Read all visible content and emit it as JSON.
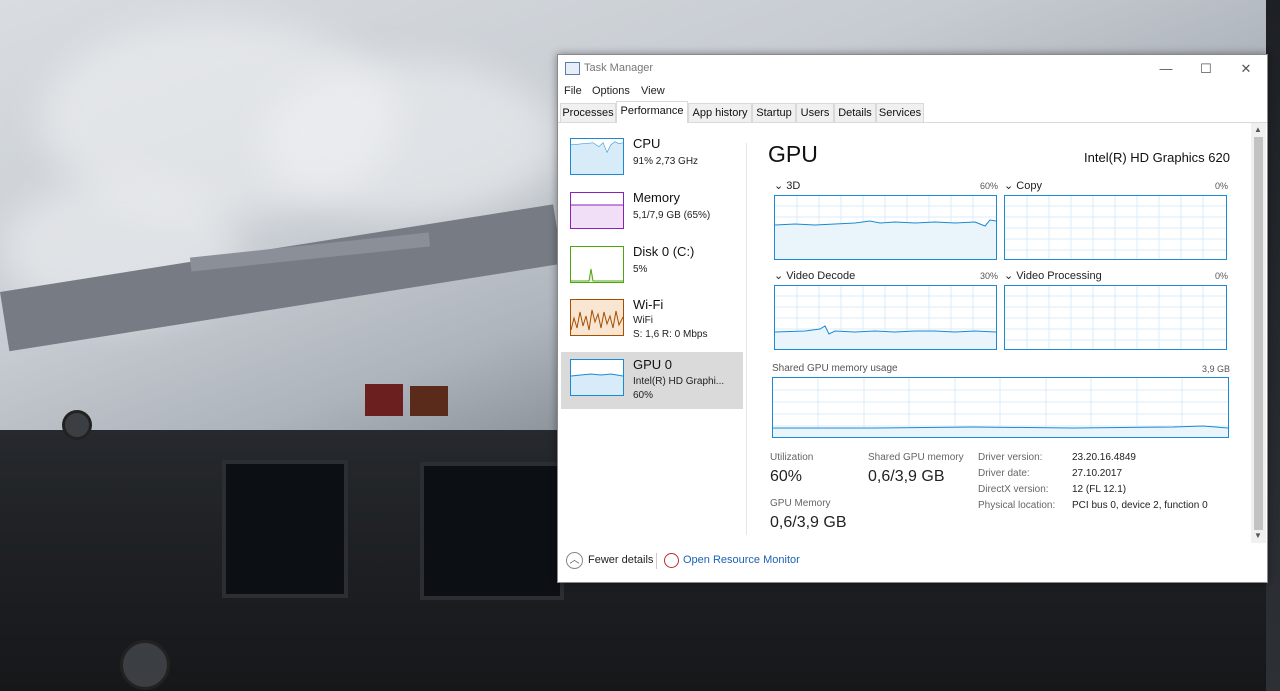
{
  "window": {
    "title": "Task Manager",
    "controls": {
      "minimize": "—",
      "maximize": "☐",
      "close": "✕"
    }
  },
  "menu": [
    "File",
    "Options",
    "View"
  ],
  "tabs": [
    "Processes",
    "Performance",
    "App history",
    "Startup",
    "Users",
    "Details",
    "Services"
  ],
  "active_tab": "Performance",
  "sidebar": [
    {
      "title": "CPU",
      "lines": [
        "91% 2,73 GHz"
      ],
      "color": "#1a8ad4"
    },
    {
      "title": "Memory",
      "lines": [
        "5,1/7,9 GB (65%)"
      ],
      "color": "#8b22b8"
    },
    {
      "title": "Disk 0 (C:)",
      "lines": [
        "5%"
      ],
      "color": "#4da60c"
    },
    {
      "title": "Wi-Fi",
      "lines": [
        "WiFi",
        "S: 1,6 R: 0 Mbps"
      ],
      "color": "#a74f01"
    },
    {
      "title": "GPU 0",
      "lines": [
        "Intel(R) HD Graphi...",
        "60%"
      ],
      "color": "#1a8ad4"
    }
  ],
  "gpu": {
    "heading": "GPU",
    "model": "Intel(R) HD Graphics 620",
    "engines": [
      {
        "name": "3D",
        "max": "60%"
      },
      {
        "name": "Copy",
        "max": "0%"
      },
      {
        "name": "Video Decode",
        "max": "30%"
      },
      {
        "name": "Video Processing",
        "max": "0%"
      }
    ],
    "shared_label": "Shared GPU memory usage",
    "shared_max": "3,9 GB",
    "stats": {
      "utilization_label": "Utilization",
      "utilization": "60%",
      "shared_label": "Shared GPU memory",
      "shared": "0,6/3,9 GB",
      "gpu_memory_label": "GPU Memory",
      "gpu_memory": "0,6/3,9 GB"
    },
    "info": [
      {
        "k": "Driver version:",
        "v": "23.20.16.4849"
      },
      {
        "k": "Driver date:",
        "v": "27.10.2017"
      },
      {
        "k": "DirectX version:",
        "v": "12 (FL 12.1)"
      },
      {
        "k": "Physical location:",
        "v": "PCI bus 0, device 2, function 0"
      }
    ]
  },
  "footer": {
    "fewer": "Fewer details",
    "monitor": "Open Resource Monitor"
  },
  "colors": {
    "accent": "#1a8ad4",
    "link": "#1a62b6"
  }
}
